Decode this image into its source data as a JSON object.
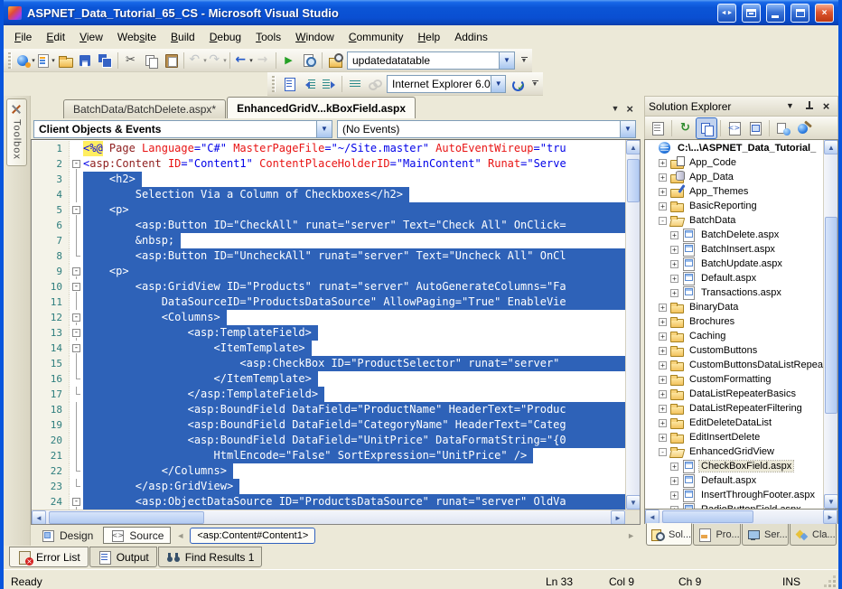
{
  "window": {
    "title": "ASPNET_Data_Tutorial_65_CS - Microsoft Visual Studio",
    "buttons": [
      "float-window",
      "dock-window",
      "minimize",
      "maximize",
      "close"
    ]
  },
  "menu": {
    "items": [
      {
        "label": "File",
        "u": 0
      },
      {
        "label": "Edit",
        "u": 0
      },
      {
        "label": "View",
        "u": 0
      },
      {
        "label": "Website",
        "u": 3
      },
      {
        "label": "Build",
        "u": 0
      },
      {
        "label": "Debug",
        "u": 0
      },
      {
        "label": "Tools",
        "u": 0
      },
      {
        "label": "Window",
        "u": 0
      },
      {
        "label": "Community",
        "u": 0
      },
      {
        "label": "Help",
        "u": 0
      },
      {
        "label": "Addins",
        "u": -1
      }
    ]
  },
  "toolbar_main": {
    "buttons": [
      {
        "n": "new-website",
        "dd": 1
      },
      {
        "n": "add-item",
        "dd": 1
      },
      {
        "n": "open-file"
      },
      {
        "n": "save"
      },
      {
        "n": "save-all"
      },
      "|",
      {
        "n": "cut"
      },
      {
        "n": "copy"
      },
      {
        "n": "paste"
      },
      "|",
      {
        "n": "undo",
        "dd": 1,
        "dis": 1
      },
      {
        "n": "redo",
        "dd": 1,
        "dis": 1
      },
      "|",
      {
        "n": "navigate-back",
        "dd": 1
      },
      {
        "n": "navigate-forward",
        "dis": 1
      },
      "|",
      {
        "n": "start-debug"
      },
      {
        "n": "view-in-browser"
      },
      "|",
      {
        "n": "find-in-files"
      }
    ],
    "combo_value": "updatedatatable"
  },
  "toolbar_format": {
    "buttons": [
      {
        "n": "show-format-marks"
      },
      {
        "n": "decrease-indent"
      },
      {
        "n": "increase-indent"
      },
      "|",
      {
        "n": "display-lines"
      },
      {
        "n": "hyperlink",
        "dis": 1
      }
    ],
    "combo_value": "Internet Explorer 6.0",
    "after_buttons": [
      {
        "n": "check-accessibility"
      }
    ]
  },
  "toolbox": {
    "label": "Toolbox"
  },
  "editor": {
    "tabs": [
      {
        "label": "BatchData/BatchDelete.aspx*",
        "active": false
      },
      {
        "label": "EnhancedGridV...kBoxField.aspx",
        "active": true
      }
    ],
    "combos": {
      "objects": "Client Objects & Events",
      "events": "(No Events)"
    },
    "lines": [
      {
        "n": 1,
        "f": "",
        "tokens": [
          {
            "c": "dir",
            "t": "<%@"
          },
          {
            "c": "tag",
            "t": " Page "
          },
          {
            "c": "attr",
            "t": "Language"
          },
          {
            "c": "val",
            "t": "=\"C#\""
          },
          {
            "c": "attr",
            "t": " MasterPageFile"
          },
          {
            "c": "val",
            "t": "=\"~/Site.master\""
          },
          {
            "c": "attr",
            "t": " AutoEventWireup"
          },
          {
            "c": "val",
            "t": "=\"tru"
          }
        ]
      },
      {
        "n": 2,
        "f": "m",
        "tokens": [
          {
            "c": "val",
            "t": "<"
          },
          {
            "c": "tag",
            "t": "asp:Content"
          },
          {
            "c": "attr",
            "t": " ID"
          },
          {
            "c": "val",
            "t": "=\"Content1\""
          },
          {
            "c": "attr",
            "t": " ContentPlaceHolderID"
          },
          {
            "c": "val",
            "t": "=\"MainContent\""
          },
          {
            "c": "attr",
            "t": " Runat"
          },
          {
            "c": "val",
            "t": "=\"Serve"
          }
        ]
      },
      {
        "n": 3,
        "f": "l",
        "sel": "    <h2>",
        "fill": false
      },
      {
        "n": 4,
        "f": "l",
        "sel": "        Selection Via a Column of Checkboxes</h2>",
        "fill": false
      },
      {
        "n": 5,
        "f": "m",
        "sel": "    <p>",
        "fill": true
      },
      {
        "n": 6,
        "f": "l",
        "sel": "        <asp:Button ID=\"CheckAll\" runat=\"server\" Text=\"Check All\" OnClick=",
        "fill": true
      },
      {
        "n": 7,
        "f": "l",
        "sel": "        &nbsp;",
        "fill": false
      },
      {
        "n": 8,
        "f": "e",
        "sel": "        <asp:Button ID=\"UncheckAll\" runat=\"server\" Text=\"Uncheck All\" OnCl",
        "fill": true
      },
      {
        "n": 9,
        "f": "m",
        "sel": "    <p>",
        "fill": true
      },
      {
        "n": 10,
        "f": "m",
        "sel": "        <asp:GridView ID=\"Products\" runat=\"server\" AutoGenerateColumns=\"Fa",
        "fill": true
      },
      {
        "n": 11,
        "f": "l",
        "sel": "            DataSourceID=\"ProductsDataSource\" AllowPaging=\"True\" EnableVie",
        "fill": true
      },
      {
        "n": 12,
        "f": "m",
        "sel": "            <Columns>",
        "fill": false
      },
      {
        "n": 13,
        "f": "m",
        "sel": "                <asp:TemplateField>",
        "fill": false
      },
      {
        "n": 14,
        "f": "m",
        "sel": "                    <ItemTemplate>",
        "fill": false
      },
      {
        "n": 15,
        "f": "l",
        "sel": "                        <asp:CheckBox ID=\"ProductSelector\" runat=\"server\"",
        "fill": true
      },
      {
        "n": 16,
        "f": "e",
        "sel": "                    </ItemTemplate>",
        "fill": false
      },
      {
        "n": 17,
        "f": "e",
        "sel": "                </asp:TemplateField>",
        "fill": false
      },
      {
        "n": 18,
        "f": "l",
        "sel": "                <asp:BoundField DataField=\"ProductName\" HeaderText=\"Produc",
        "fill": true
      },
      {
        "n": 19,
        "f": "l",
        "sel": "                <asp:BoundField DataField=\"CategoryName\" HeaderText=\"Categ",
        "fill": true
      },
      {
        "n": 20,
        "f": "l",
        "sel": "                <asp:BoundField DataField=\"UnitPrice\" DataFormatString=\"{0",
        "fill": true
      },
      {
        "n": 21,
        "f": "l",
        "sel": "                    HtmlEncode=\"False\" SortExpression=\"UnitPrice\" />",
        "fill": false
      },
      {
        "n": 22,
        "f": "e",
        "sel": "            </Columns>",
        "fill": false
      },
      {
        "n": 23,
        "f": "e",
        "sel": "        </asp:GridView>",
        "fill": false
      },
      {
        "n": 24,
        "f": "m",
        "sel": "        <asp:ObjectDataSource ID=\"ProductsDataSource\" runat=\"server\" OldVa",
        "fill": true
      }
    ],
    "selection_color": "#2e62b8"
  },
  "viewbar": {
    "design_label": "Design",
    "source_label": "Source",
    "tag_nav": "<asp:Content#Content1>"
  },
  "solution_explorer": {
    "title": "Solution Explorer",
    "header_buttons": [
      "window-menu",
      "pin",
      "close"
    ],
    "toolbar_buttons": [
      {
        "n": "properties-window"
      },
      "|",
      {
        "n": "refresh"
      },
      {
        "n": "nest-related-files",
        "sel": 1
      },
      "|",
      {
        "n": "view-code"
      },
      {
        "n": "view-designer"
      },
      "|",
      {
        "n": "copy-website"
      },
      {
        "n": "aspnet-configuration"
      }
    ],
    "tree": [
      {
        "label": "C:\\...\\ASPNET_Data_Tutorial_",
        "icon": "site-root",
        "level": 0,
        "exp": "",
        "bold": true
      },
      {
        "label": "App_Code",
        "icon": "folder-code",
        "level": 1,
        "exp": "+"
      },
      {
        "label": "App_Data",
        "icon": "folder-data",
        "level": 1,
        "exp": "+"
      },
      {
        "label": "App_Themes",
        "icon": "folder-themes",
        "level": 1,
        "exp": "+"
      },
      {
        "label": "BasicReporting",
        "icon": "folder",
        "level": 1,
        "exp": "+"
      },
      {
        "label": "BatchData",
        "icon": "folder-open",
        "level": 1,
        "exp": "-"
      },
      {
        "label": "BatchDelete.aspx",
        "icon": "aspx",
        "level": 2,
        "exp": "+"
      },
      {
        "label": "BatchInsert.aspx",
        "icon": "aspx",
        "level": 2,
        "exp": "+"
      },
      {
        "label": "BatchUpdate.aspx",
        "icon": "aspx",
        "level": 2,
        "exp": "+"
      },
      {
        "label": "Default.aspx",
        "icon": "aspx",
        "level": 2,
        "exp": "+"
      },
      {
        "label": "Transactions.aspx",
        "icon": "aspx",
        "level": 2,
        "exp": "+"
      },
      {
        "label": "BinaryData",
        "icon": "folder",
        "level": 1,
        "exp": "+"
      },
      {
        "label": "Brochures",
        "icon": "folder",
        "level": 1,
        "exp": "+"
      },
      {
        "label": "Caching",
        "icon": "folder",
        "level": 1,
        "exp": "+"
      },
      {
        "label": "CustomButtons",
        "icon": "folder",
        "level": 1,
        "exp": "+"
      },
      {
        "label": "CustomButtonsDataListRepeat",
        "icon": "folder",
        "level": 1,
        "exp": "+"
      },
      {
        "label": "CustomFormatting",
        "icon": "folder",
        "level": 1,
        "exp": "+"
      },
      {
        "label": "DataListRepeaterBasics",
        "icon": "folder",
        "level": 1,
        "exp": "+"
      },
      {
        "label": "DataListRepeaterFiltering",
        "icon": "folder",
        "level": 1,
        "exp": "+"
      },
      {
        "label": "EditDeleteDataList",
        "icon": "folder",
        "level": 1,
        "exp": "+"
      },
      {
        "label": "EditInsertDelete",
        "icon": "folder",
        "level": 1,
        "exp": "+"
      },
      {
        "label": "EnhancedGridView",
        "icon": "folder-open",
        "level": 1,
        "exp": "-"
      },
      {
        "label": "CheckBoxField.aspx",
        "icon": "aspx",
        "level": 2,
        "exp": "+",
        "selected": true
      },
      {
        "label": "Default.aspx",
        "icon": "aspx",
        "level": 2,
        "exp": "+"
      },
      {
        "label": "InsertThroughFooter.aspx",
        "icon": "aspx",
        "level": 2,
        "exp": "+"
      },
      {
        "label": "RadioButtonField.aspx",
        "icon": "aspx",
        "level": 2,
        "exp": "+"
      }
    ],
    "tabs": [
      {
        "label": "Sol...",
        "icon": "solution-explorer",
        "active": true
      },
      {
        "label": "Pro...",
        "icon": "properties-tab",
        "active": false
      },
      {
        "label": "Ser...",
        "icon": "server-explorer",
        "active": false
      },
      {
        "label": "Cla...",
        "icon": "class-view",
        "active": false
      }
    ]
  },
  "bottom_tabs": [
    {
      "label": "Error List",
      "icon": "error-list",
      "active": true
    },
    {
      "label": "Output",
      "icon": "output",
      "active": false
    },
    {
      "label": "Find Results 1",
      "icon": "find-results",
      "active": false
    }
  ],
  "status": {
    "ready": "Ready",
    "line": "Ln 33",
    "column": "Col 9",
    "character": "Ch 9",
    "mode": "INS"
  }
}
